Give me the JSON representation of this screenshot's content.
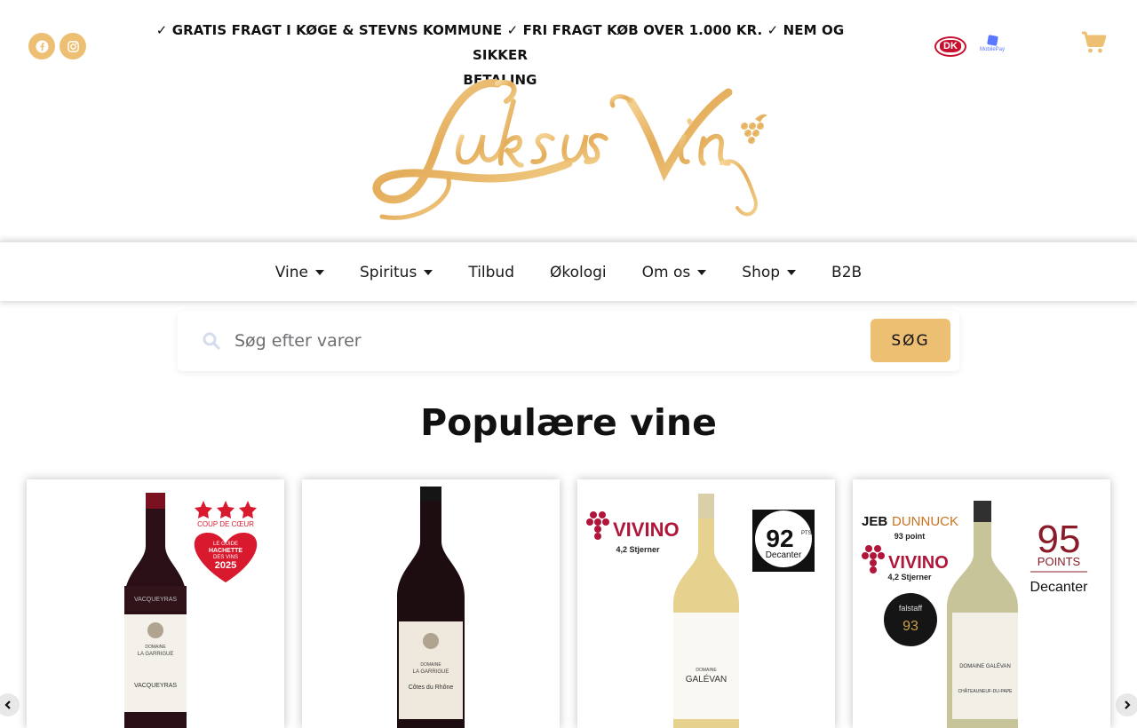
{
  "header": {
    "social": [
      {
        "name": "facebook",
        "icon": "facebook-icon"
      },
      {
        "name": "instagram",
        "icon": "instagram-icon"
      }
    ],
    "announcement_line1": "✓ GRATIS FRAGT I KØGE & STEVNS KOMMUNE ✓ FRI FRAGT KØB OVER 1.000 KR. ✓ NEM OG SIKKER",
    "announcement_line2": "BETALING",
    "payment": {
      "dankort_label": "DK",
      "mobilepay_label": "MobilePay"
    },
    "cart_icon": "shopping-cart-icon",
    "logo_text": "Luksus Vin"
  },
  "nav": {
    "items": [
      {
        "label": "Vine",
        "has_dropdown": true
      },
      {
        "label": "Spiritus",
        "has_dropdown": true
      },
      {
        "label": "Tilbud",
        "has_dropdown": false
      },
      {
        "label": "Økologi",
        "has_dropdown": false
      },
      {
        "label": "Om os",
        "has_dropdown": true
      },
      {
        "label": "Shop",
        "has_dropdown": true
      },
      {
        "label": "B2B",
        "has_dropdown": false
      }
    ]
  },
  "search": {
    "placeholder": "Søg efter varer",
    "button_label": "SØG"
  },
  "section": {
    "title": "Populære vine"
  },
  "products": [
    {
      "badge1_line1": "COUP DE CŒUR",
      "badge1_line2": "LE GUIDE",
      "badge1_line3": "HACHETTE",
      "badge1_line4": "DES VINS",
      "badge1_line5": "2025",
      "label_top": "VACQUEYRAS",
      "label_mid": "DOMAINE",
      "label_name": "LA GARRIGUE",
      "label_bottom": "VACQUEYRAS"
    },
    {
      "label_mid": "DOMAINE",
      "label_name": "LA GARRIGUE",
      "label_bottom": "Côtes du Rhône"
    },
    {
      "vivino": "VIVINO",
      "vivino_stars": "4,2 Stjerner",
      "decanter_score": "92",
      "decanter_pts": "PTS.",
      "decanter_label": "Decanter",
      "label_mid": "DOMAINE",
      "label_name": "GALÉVAN"
    },
    {
      "jeb": "JEB",
      "jeb_name": "DUNNUCK",
      "jeb_points": "93 point",
      "vivino": "VIVINO",
      "vivino_stars": "4,2 Stjerner",
      "falstaff": "falstaff",
      "falstaff_score": "93",
      "points_score": "95",
      "points_label": "POINTS",
      "points_source": "Decanter",
      "label_mid": "DOMAINE GALÉVAN",
      "label_bottom": "CHÂTEAUNEUF-DU-PAPE"
    }
  ],
  "colors": {
    "accent": "#edbf72",
    "wine_red": "#b0163a",
    "text": "#111111"
  }
}
